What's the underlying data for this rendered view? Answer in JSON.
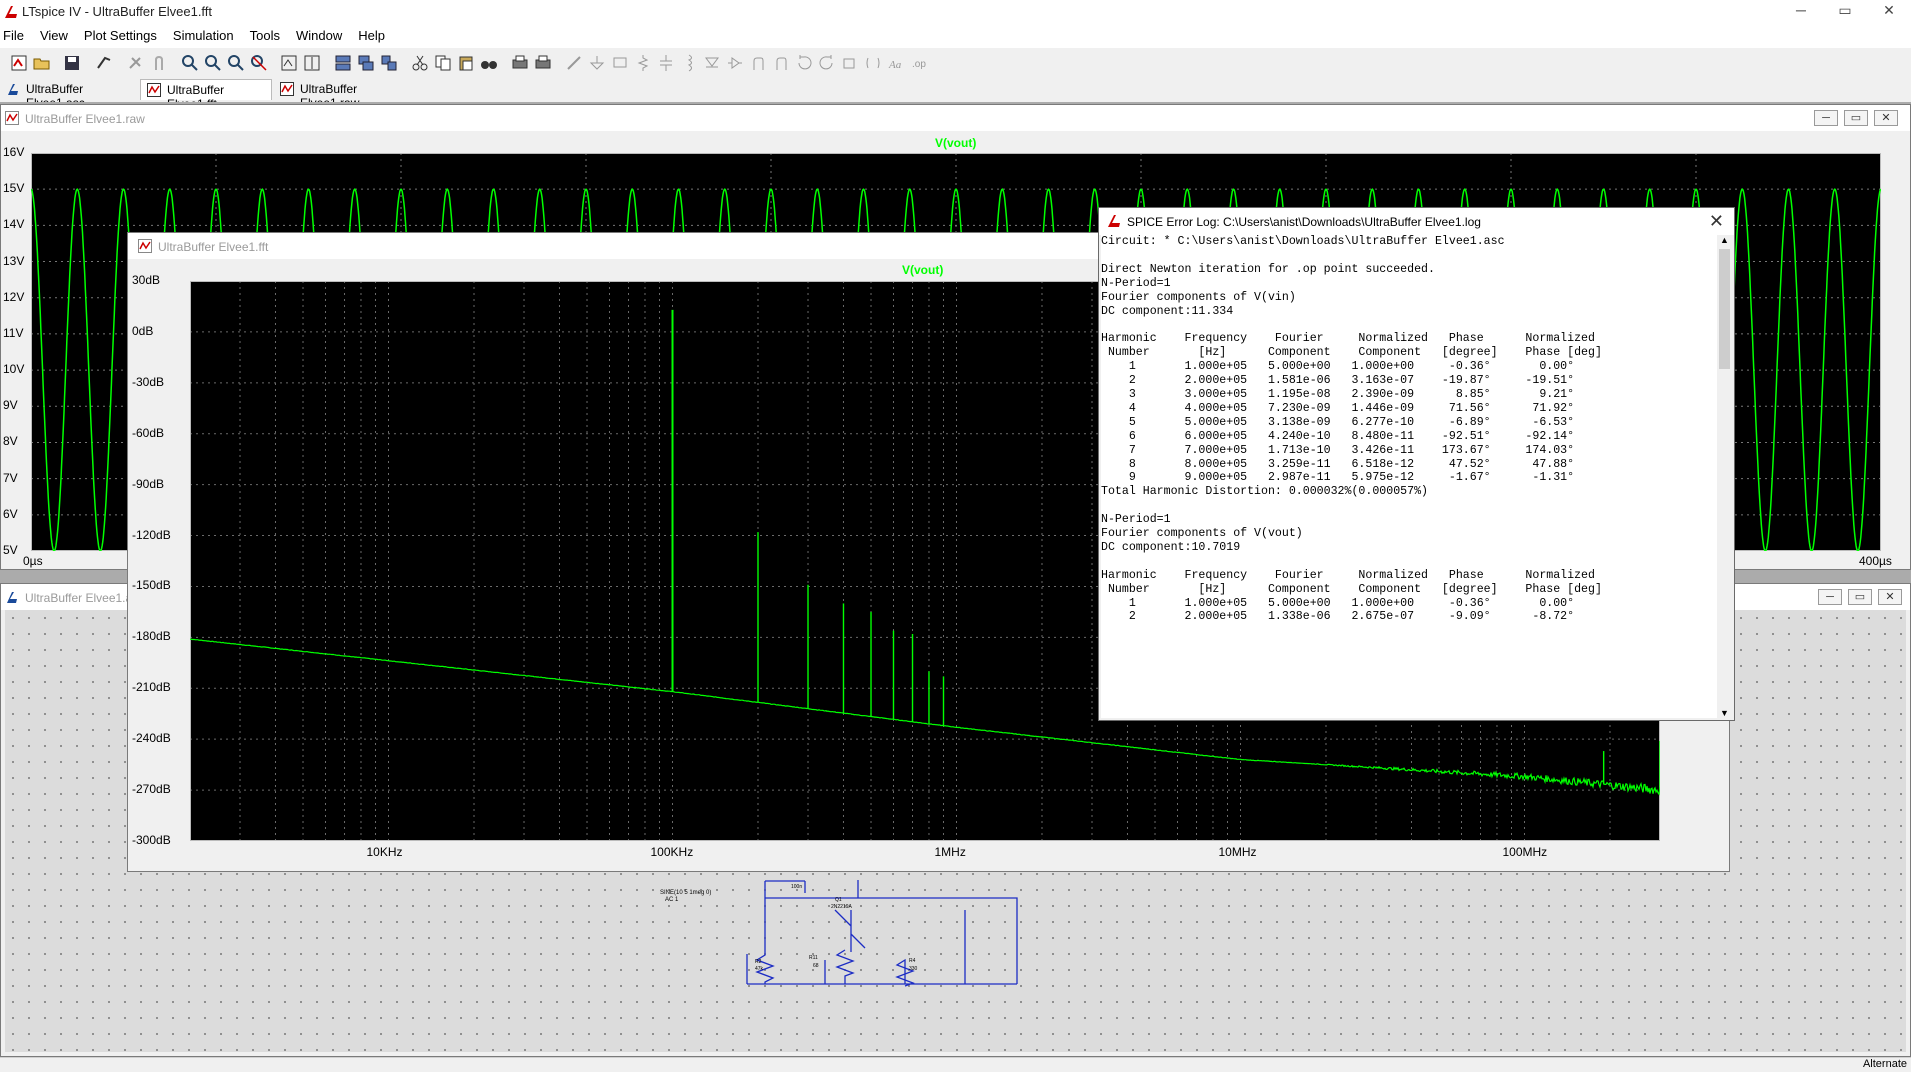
{
  "app": {
    "title": "LTspice IV - UltraBuffer Elvee1.fft",
    "window_controls": [
      "─",
      "▭",
      "✕"
    ]
  },
  "menu": [
    "File",
    "View",
    "Plot Settings",
    "Simulation",
    "Tools",
    "Window",
    "Help"
  ],
  "toolbar_icons": [
    "new-schematic",
    "open",
    "save",
    "control-panel",
    "run",
    "halt",
    "zoom-in",
    "zoom-pan",
    "zoom-out",
    "zoom-full",
    "autorange",
    "autorange-y",
    "tile-horizontal",
    "tile-vertical",
    "cascade",
    "cut",
    "copy",
    "paste",
    "find",
    "print-preview",
    "print",
    "wire",
    "ground",
    "label",
    "resistor",
    "capacitor",
    "inductor",
    "diode",
    "component",
    "move",
    "drag",
    "undo",
    "redo",
    "rotate",
    "mirror",
    "text",
    "spice-directive"
  ],
  "tabs": [
    {
      "label": "UltraBuffer Elvee1.asc",
      "icon": "schematic-icon",
      "active": false
    },
    {
      "label": "UltraBuffer Elvee1.fft",
      "icon": "waveform-icon",
      "active": true
    },
    {
      "label": "UltraBuffer Elvee1.raw",
      "icon": "waveform-icon",
      "active": false
    }
  ],
  "raw_window": {
    "title": "UltraBuffer Elvee1.raw",
    "trace": "V(vout)",
    "y_ticks": [
      "16V",
      "15V",
      "14V",
      "13V",
      "12V",
      "11V",
      "10V",
      "9V",
      "8V",
      "7V",
      "6V",
      "5V"
    ],
    "x_ticks": [
      "0µs",
      "400µs"
    ]
  },
  "schematic_window": {
    "title": "UltraBuffer Elvee1.asc",
    "source_label": [
      "SINE(10 5 1meg 0)",
      "AC 1"
    ],
    "parts": [
      "R2",
      "47k",
      "R11",
      "68",
      "Q1",
      "2N2219A",
      "R4",
      "330",
      "100n"
    ]
  },
  "fft_window": {
    "title": "UltraBuffer Elvee1.fft",
    "trace": "V(vout)",
    "y_ticks": [
      "30dB",
      "0dB",
      "-30dB",
      "-60dB",
      "-90dB",
      "-120dB",
      "-150dB",
      "-180dB",
      "-210dB",
      "-240dB",
      "-270dB",
      "-300dB"
    ],
    "x_ticks": [
      "10KHz",
      "100KHz",
      "1MHz",
      "10MHz",
      "100MHz"
    ]
  },
  "chart_data": [
    {
      "type": "line",
      "title": "V(vout)",
      "xlabel": "",
      "ylabel": "",
      "xlim": [
        0,
        400
      ],
      "x_unit": "µs",
      "ylim": [
        5,
        16
      ],
      "y_unit": "V",
      "series": [
        {
          "name": "V(vout)",
          "shape": "sine",
          "offset": 10.0,
          "amplitude": 5.0,
          "period_us": 10,
          "color": "#00ff00"
        }
      ]
    },
    {
      "type": "line",
      "title": "V(vout)",
      "xlabel": "",
      "ylabel": "",
      "x_scale": "log",
      "xlim_hz": [
        2000,
        300000000
      ],
      "ylim": [
        -300,
        30
      ],
      "y_unit": "dB",
      "series": [
        {
          "name": "V(vout)",
          "color": "#00ff00",
          "noise_floor": [
            [
              2000,
              -181
            ],
            [
              100000,
              -212
            ],
            [
              1000000,
              -233
            ],
            [
              10000000,
              -252
            ],
            [
              100000000,
              -262
            ],
            [
              300000000,
              -270
            ]
          ],
          "peaks": [
            [
              100000,
              13
            ],
            [
              200000,
              -118
            ],
            [
              300000,
              -149
            ],
            [
              400000,
              -160
            ],
            [
              500000,
              -165
            ],
            [
              600000,
              -176
            ],
            [
              700000,
              -178
            ],
            [
              800000,
              -200
            ],
            [
              900000,
              -203
            ],
            [
              190000000,
              -247
            ],
            [
              300000000,
              -241
            ]
          ]
        }
      ]
    }
  ],
  "error_log": {
    "title": "SPICE Error Log: C:\\Users\\anist\\Downloads\\UltraBuffer Elvee1.log",
    "close": "✕",
    "lines": [
      "Circuit: * C:\\Users\\anist\\Downloads\\UltraBuffer Elvee1.asc",
      "",
      "Direct Newton iteration for .op point succeeded.",
      "N-Period=1",
      "Fourier components of V(vin)",
      "DC component:11.334",
      "",
      "Harmonic    Frequency    Fourier     Normalized   Phase      Normalized",
      " Number       [Hz]      Component    Component   [degree]    Phase [deg]",
      "    1       1.000e+05   5.000e+00   1.000e+00     -0.36°       0.00°",
      "    2       2.000e+05   1.581e-06   3.163e-07    -19.87°     -19.51°",
      "    3       3.000e+05   1.195e-08   2.390e-09      8.85°       9.21°",
      "    4       4.000e+05   7.230e-09   1.446e-09     71.56°      71.92°",
      "    5       5.000e+05   3.138e-09   6.277e-10     -6.89°      -6.53°",
      "    6       6.000e+05   4.240e-10   8.480e-11    -92.51°     -92.14°",
      "    7       7.000e+05   1.713e-10   3.426e-11    173.67°     174.03°",
      "    8       8.000e+05   3.259e-11   6.518e-12     47.52°      47.88°",
      "    9       9.000e+05   2.987e-11   5.975e-12     -1.67°      -1.31°",
      "Total Harmonic Distortion: 0.000032%(0.000057%)",
      "",
      "N-Period=1",
      "Fourier components of V(vout)",
      "DC component:10.7019",
      "",
      "Harmonic    Frequency    Fourier     Normalized   Phase      Normalized",
      " Number       [Hz]      Component    Component   [degree]    Phase [deg]",
      "    1       1.000e+05   5.000e+00   1.000e+00     -0.36°       0.00°",
      "    2       2.000e+05   1.338e-06   2.675e-07     -9.09°      -8.72°"
    ]
  },
  "status": {
    "right": "Alternate"
  }
}
